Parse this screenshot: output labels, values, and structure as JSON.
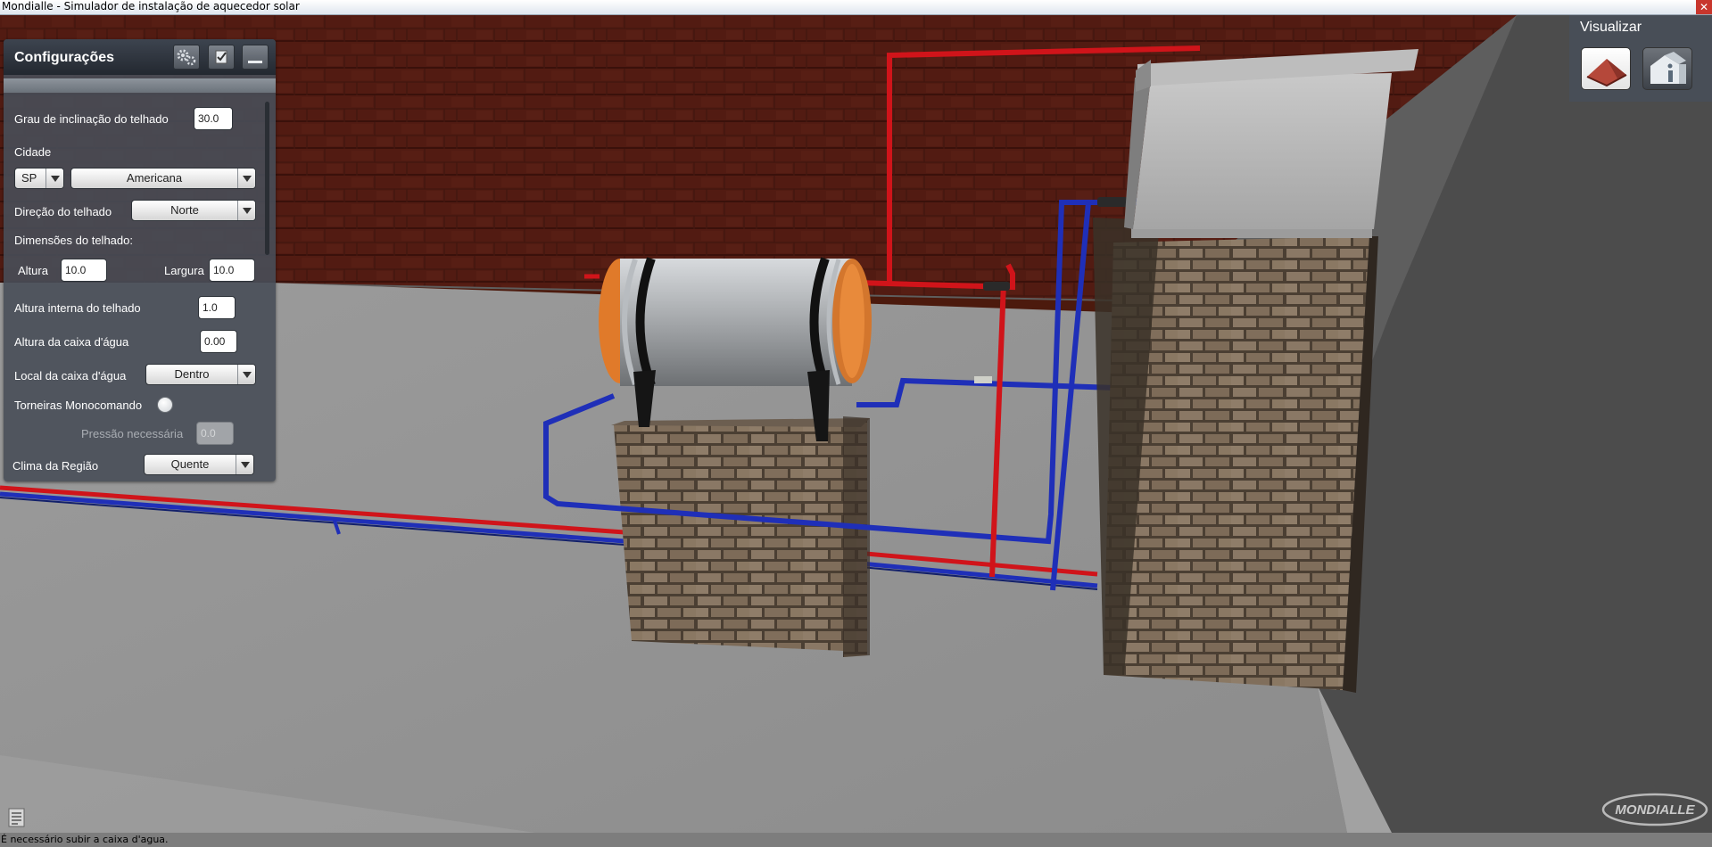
{
  "window": {
    "title": "Mondialle - Simulador de instalação de aquecedor solar",
    "close_symbol": "✕"
  },
  "config_panel": {
    "title": "Configurações",
    "header_icons": [
      "gears-icon",
      "checkbox-icon",
      "minimize-icon"
    ],
    "roof_inclination": {
      "label": "Grau de inclinação do telhado",
      "value": "30.0"
    },
    "city": {
      "label": "Cidade",
      "state": "SP",
      "name": "Americana"
    },
    "roof_direction": {
      "label": "Direção do telhado",
      "value": "Norte"
    },
    "roof_dimensions": {
      "label": "Dimensões do telhado:",
      "height_label": "Altura",
      "height_value": "10.0",
      "width_label": "Largura",
      "width_value": "10.0"
    },
    "internal_roof_height": {
      "label": "Altura interna do telhado",
      "value": "1.0"
    },
    "tank_height": {
      "label": "Altura da caixa d'água",
      "value": "0.00"
    },
    "tank_location": {
      "label": "Local da caixa d'água",
      "value": "Dentro"
    },
    "single_lever_faucets": {
      "label": "Torneiras Monocomando",
      "enabled": false
    },
    "required_pressure": {
      "label": "Pressão necessária",
      "value": "0.0"
    },
    "climate": {
      "label": "Clima da Região",
      "value": "Quente"
    }
  },
  "view_panel": {
    "title": "Visualizar",
    "buttons": [
      "roof-view-icon",
      "house-info-icon"
    ]
  },
  "status": {
    "message": "É necessário subir a caixa d'agua."
  },
  "logo": {
    "text": "MONDIALLE"
  },
  "scene": {
    "pipe_hot_color": "#d0141a",
    "pipe_cold_color": "#1f2fb8"
  }
}
